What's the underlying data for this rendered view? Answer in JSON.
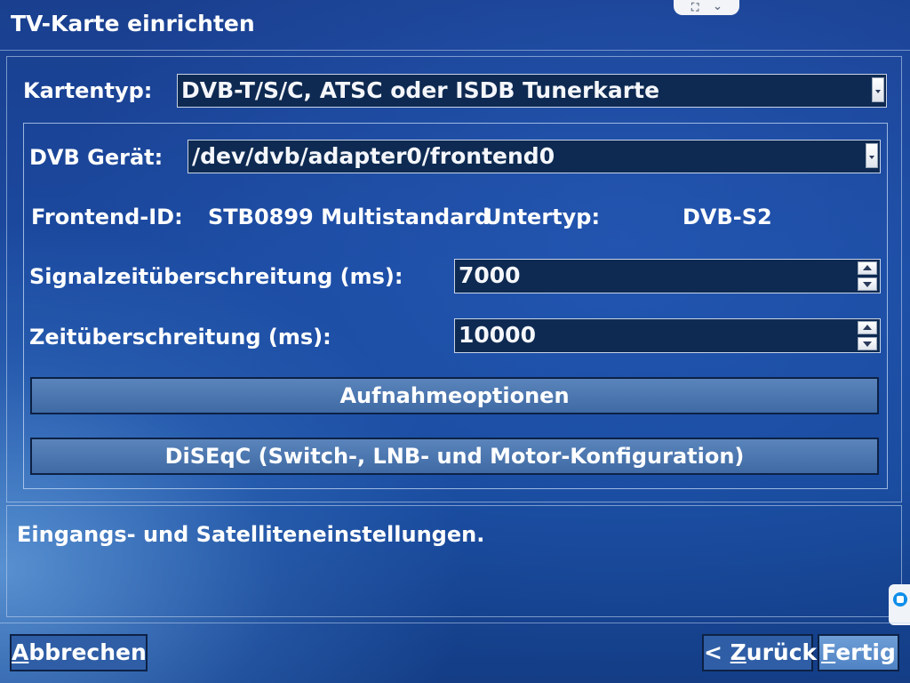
{
  "window": {
    "title": "TV-Karte einrichten"
  },
  "card_type": {
    "label": "Kartentyp:",
    "value": "DVB-T/S/C, ATSC oder ISDB Tunerkarte"
  },
  "device": {
    "label": "DVB Gerät:",
    "value": "/dev/dvb/adapter0/frontend0"
  },
  "frontend": {
    "id_label": "Frontend-ID:",
    "id_value": "STB0899 Multistandard",
    "subtype_label": "Untertyp:",
    "subtype_value": "DVB-S2"
  },
  "signal_timeout": {
    "label": "Signalzeitüberschreitung (ms):",
    "value": "7000"
  },
  "timeout": {
    "label": "Zeitüberschreitung (ms):",
    "value": "10000"
  },
  "buttons": {
    "recording_options": "Aufnahmeoptionen",
    "diseqc": "DiSEqC (Switch-, LNB- und Motor-Konfiguration)",
    "cancel_first": "A",
    "cancel_rest": "bbrechen",
    "back_prefix": "< ",
    "back_first": "Z",
    "back_rest": "urück",
    "finish_first": "F",
    "finish_rest": "ertig"
  },
  "status": {
    "text": "Eingangs- und Satelliteneinstellungen."
  },
  "icons": [
    "fullscreen-icon",
    "chevron-down-icon",
    "teamviewer-icon",
    "dropdown-arrow-icon",
    "spin-up-icon",
    "spin-down-icon"
  ]
}
